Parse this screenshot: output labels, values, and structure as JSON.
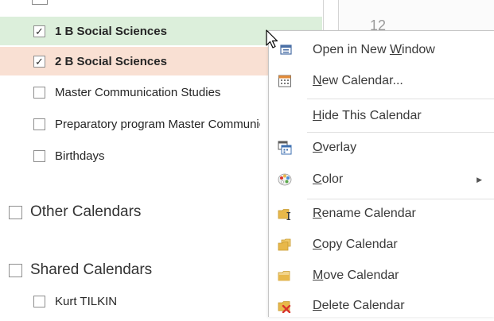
{
  "nav": {
    "items": [
      {
        "label": "1 B Social Sciences",
        "checked": true,
        "bold": true,
        "highlight": "#dcefdb"
      },
      {
        "label": "2 B Social Sciences",
        "checked": true,
        "bold": true,
        "highlight": "#f9e0d3"
      },
      {
        "label": "Master Communication Studies",
        "checked": false,
        "bold": false
      },
      {
        "label": "Preparatory program Master Communication Studies",
        "checked": false,
        "bold": false
      },
      {
        "label": "Birthdays",
        "checked": false,
        "bold": false
      }
    ],
    "groups": [
      {
        "label": "Other Calendars",
        "checked": false
      },
      {
        "label": "Shared Calendars",
        "checked": false
      }
    ],
    "shared_items": [
      {
        "label": "Kurt TILKIN",
        "checked": false
      }
    ],
    "check_glyph": "✓"
  },
  "grid": {
    "visible_number": "12"
  },
  "context_menu": {
    "items": [
      {
        "pre": "Open in New ",
        "accel": "W",
        "post": "indow",
        "icon": "open-new-window-icon",
        "has_submenu": false
      },
      {
        "pre": "",
        "accel": "N",
        "post": "ew Calendar...",
        "icon": "new-calendar-icon",
        "has_submenu": false
      },
      {
        "pre": "",
        "accel": "H",
        "post": "ide This Calendar",
        "icon": "",
        "has_submenu": false
      },
      {
        "pre": "",
        "accel": "O",
        "post": "verlay",
        "icon": "overlay-icon",
        "has_submenu": false
      },
      {
        "pre": "",
        "accel": "C",
        "post": "olor",
        "icon": "color-palette-icon",
        "has_submenu": true
      },
      {
        "pre": "",
        "accel": "R",
        "post": "ename Calendar",
        "icon": "rename-folder-icon",
        "has_submenu": false
      },
      {
        "pre": "",
        "accel": "C",
        "post": "opy Calendar",
        "icon": "copy-folder-icon",
        "has_submenu": false
      },
      {
        "pre": "",
        "accel": "M",
        "post": "ove Calendar",
        "icon": "move-folder-icon",
        "has_submenu": false
      },
      {
        "pre": "",
        "accel": "D",
        "post": "elete Calendar",
        "icon": "delete-folder-icon",
        "has_submenu": false
      }
    ],
    "submenu_glyph": "▶"
  },
  "colors": {
    "row_green": "#dcefdb",
    "row_orange": "#f9e0d3",
    "folder_yellow": "#e8b84a",
    "delete_red": "#d9342b",
    "menu_border": "#c6c6c6"
  }
}
